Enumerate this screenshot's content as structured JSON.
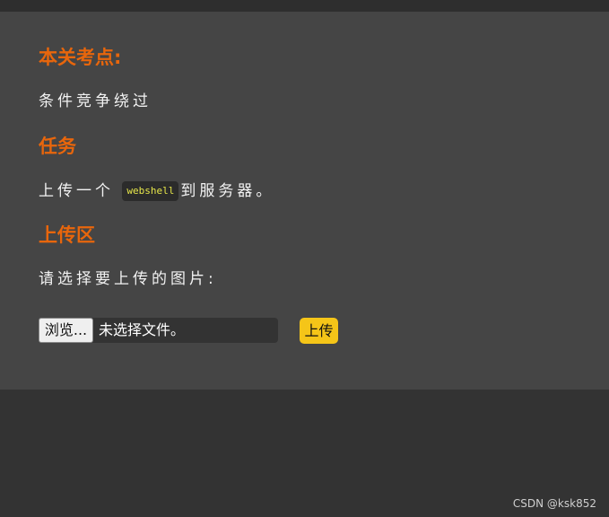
{
  "sections": {
    "key_point": {
      "title": "本关考点:",
      "text": "条件竞争绕过"
    },
    "task": {
      "title": "任务",
      "text_before": "上传一个",
      "code": "webshell",
      "text_after": "到服务器。"
    },
    "upload_area": {
      "title": "上传区",
      "prompt": "请选择要上传的图片:"
    }
  },
  "file_input": {
    "browse_label": "浏览...",
    "status": "未选择文件。"
  },
  "upload_button": {
    "label": "上传"
  },
  "watermark": "CSDN @ksk852",
  "colors": {
    "heading": "#e8660c",
    "panel": "#454545",
    "background": "#333333",
    "code_text": "#e6e64a",
    "upload_button": "#f5c518"
  }
}
